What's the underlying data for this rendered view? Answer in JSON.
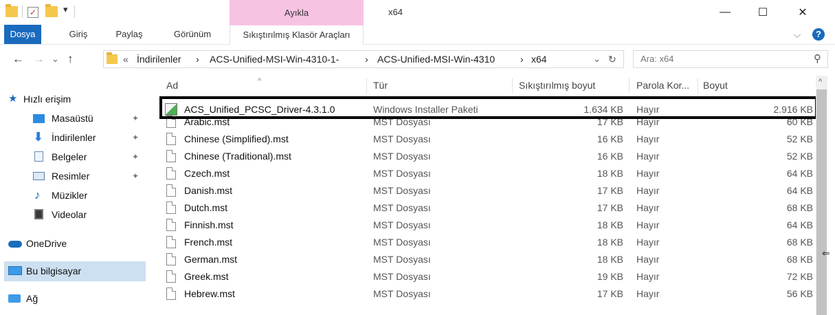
{
  "titlebar": {
    "contextual_group": "Ayıkla",
    "window_title": "x64",
    "minimize": "—",
    "maximize": "☐",
    "close": "✕"
  },
  "ribbon": {
    "tabs": [
      "Dosya",
      "Giriş",
      "Paylaş",
      "Görünüm"
    ],
    "context_tab": "Sıkıştırılmış Klasör Araçları",
    "chevron": "⌵",
    "help": "?"
  },
  "address": {
    "back": "←",
    "forward": "→",
    "recent": "⌄",
    "up": "↑",
    "overflow": "«",
    "crumbs": [
      "İndirilenler",
      "ACS-Unified-MSI-Win-4310-1-",
      "ACS-Unified-MSI-Win-4310",
      "x64"
    ],
    "separator": "›",
    "dropdown": "⌄",
    "refresh": "↻"
  },
  "search": {
    "placeholder": "Ara: x64",
    "icon": "⚲"
  },
  "nav": {
    "quick_access": "Hızlı erişim",
    "items": [
      "Masaüstü",
      "İndirilenler",
      "Belgeler",
      "Resimler",
      "Müzikler",
      "Videolar"
    ],
    "pin": "✦",
    "onedrive": "OneDrive",
    "this_pc": "Bu bilgisayar",
    "network": "Ağ"
  },
  "columns": {
    "name": "Ad",
    "type": "Tür",
    "compressed": "Sıkıştırılmış boyut",
    "password": "Parola Kor...",
    "size": "Boyut",
    "sort_indicator": "^"
  },
  "files": [
    {
      "name": "ACS_Unified_PCSC_Driver-4.3.1.0",
      "type": "Windows Installer Paketi",
      "compressed": "1.634 KB",
      "password": "Hayır",
      "size": "2.916 KB"
    },
    {
      "name": "Arabic.mst",
      "type": "MST Dosyası",
      "compressed": "17 KB",
      "password": "Hayır",
      "size": "60 KB"
    },
    {
      "name": "Chinese (Simplified).mst",
      "type": "MST Dosyası",
      "compressed": "16 KB",
      "password": "Hayır",
      "size": "52 KB"
    },
    {
      "name": "Chinese (Traditional).mst",
      "type": "MST Dosyası",
      "compressed": "16 KB",
      "password": "Hayır",
      "size": "52 KB"
    },
    {
      "name": "Czech.mst",
      "type": "MST Dosyası",
      "compressed": "18 KB",
      "password": "Hayır",
      "size": "64 KB"
    },
    {
      "name": "Danish.mst",
      "type": "MST Dosyası",
      "compressed": "17 KB",
      "password": "Hayır",
      "size": "64 KB"
    },
    {
      "name": "Dutch.mst",
      "type": "MST Dosyası",
      "compressed": "17 KB",
      "password": "Hayır",
      "size": "68 KB"
    },
    {
      "name": "Finnish.mst",
      "type": "MST Dosyası",
      "compressed": "18 KB",
      "password": "Hayır",
      "size": "64 KB"
    },
    {
      "name": "French.mst",
      "type": "MST Dosyası",
      "compressed": "18 KB",
      "password": "Hayır",
      "size": "68 KB"
    },
    {
      "name": "German.mst",
      "type": "MST Dosyası",
      "compressed": "18 KB",
      "password": "Hayır",
      "size": "68 KB"
    },
    {
      "name": "Greek.mst",
      "type": "MST Dosyası",
      "compressed": "19 KB",
      "password": "Hayır",
      "size": "72 KB"
    },
    {
      "name": "Hebrew.mst",
      "type": "MST Dosyası",
      "compressed": "17 KB",
      "password": "Hayır",
      "size": "56 KB"
    }
  ],
  "scrollbar": {
    "up_arrow": "^"
  },
  "colors": {
    "accent": "#1a6bbd",
    "context_tab": "#f7c3e3",
    "highlight_border": "#000000"
  }
}
